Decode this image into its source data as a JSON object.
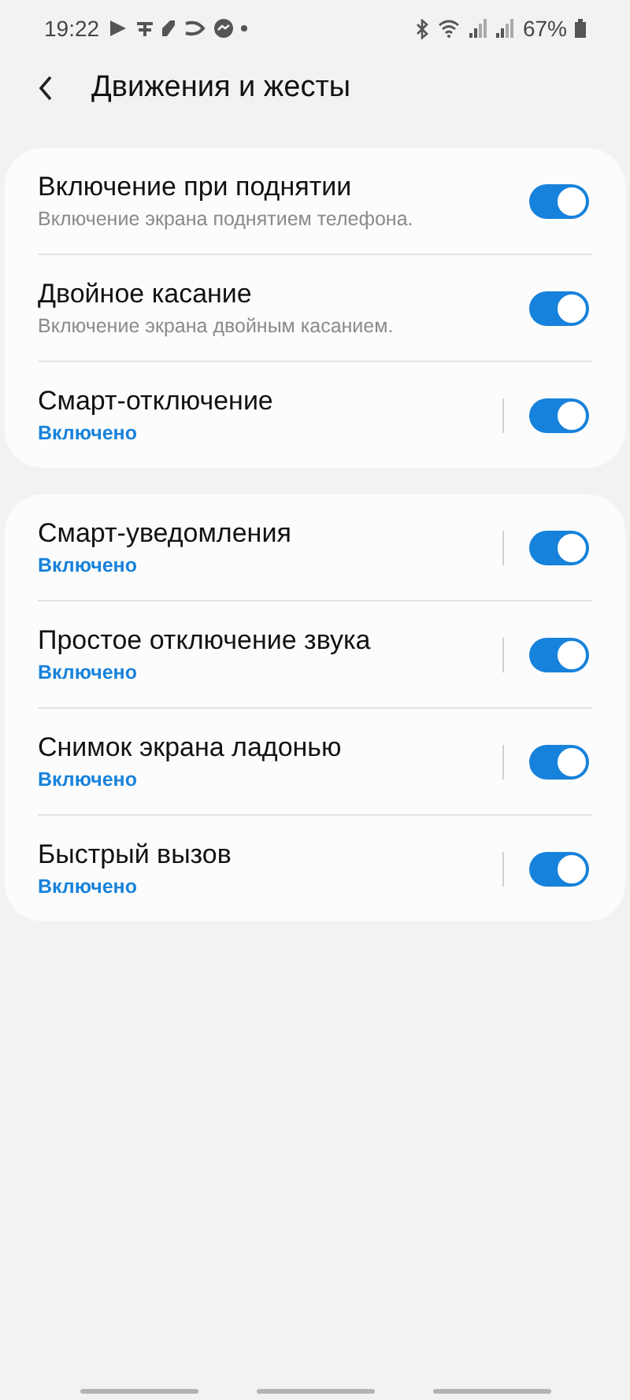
{
  "status_bar": {
    "time": "19:22",
    "battery": "67%"
  },
  "header": {
    "title": "Движения и жесты"
  },
  "groups": [
    {
      "items": [
        {
          "kind": "subtitle",
          "title": "Включение при поднятии",
          "subtitle": "Включение экрана поднятием телефона.",
          "on": true
        },
        {
          "kind": "subtitle",
          "title": "Двойное касание",
          "subtitle": "Включение экрана двойным касанием.",
          "on": true
        },
        {
          "kind": "status",
          "title": "Смарт-отключение",
          "subtitle": "Включено",
          "on": true
        }
      ]
    },
    {
      "items": [
        {
          "kind": "status",
          "title": "Смарт-уведомления",
          "subtitle": "Включено",
          "on": true
        },
        {
          "kind": "status",
          "title": "Простое отключение звука",
          "subtitle": "Включено",
          "on": true
        },
        {
          "kind": "status",
          "title": "Снимок экрана ладонью",
          "subtitle": "Включено",
          "on": true
        },
        {
          "kind": "status",
          "title": "Быстрый вызов",
          "subtitle": "Включено",
          "on": true
        }
      ]
    }
  ]
}
